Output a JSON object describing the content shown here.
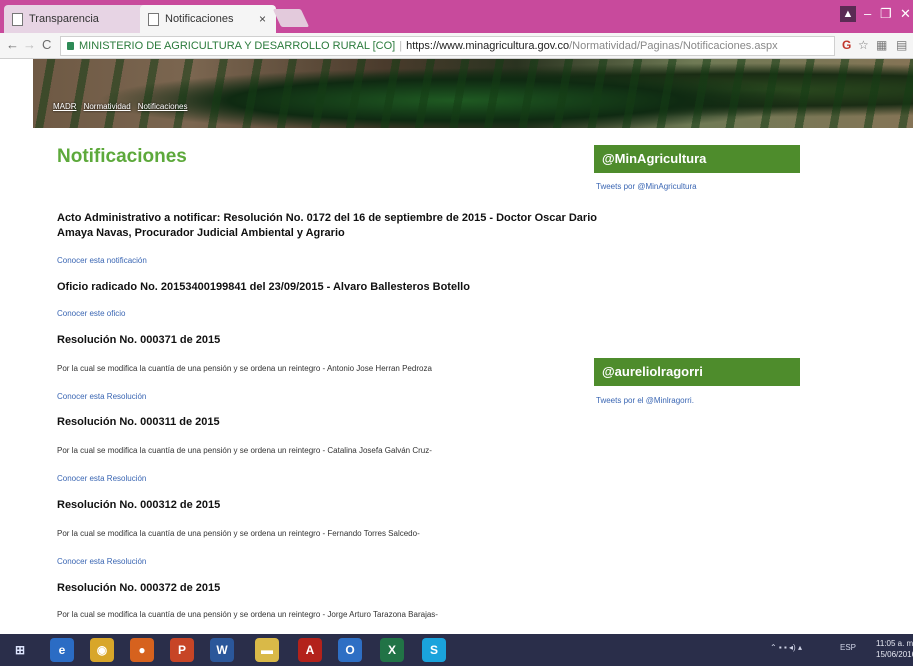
{
  "browser": {
    "tabs": [
      {
        "label": "Transparencia"
      },
      {
        "label": "Notificaciones"
      }
    ],
    "address": {
      "site_identity": "MINISTERIO DE AGRICULTURA Y DESARROLLO RURAL [CO]",
      "url_host": "https://www.minagricultura.gov.co",
      "url_path": "/Normatividad/Paginas/Notificaciones.aspx"
    }
  },
  "breadcrumb": [
    "MADR",
    "Normatividad",
    "Notificaciones"
  ],
  "page_title": "Notificaciones",
  "items": [
    {
      "title": "Acto Administrativo a notificar: Resolución No. 0172 del 16 de septiembre de 2015 - Doctor Oscar Dario Amaya Navas, Procurador Judicial Ambiental y Agrario",
      "link": "Conocer esta notificación"
    },
    {
      "title": "Oficio radicado No. 20153400199841 del 23/09/2015 - Alvaro Ballesteros Botello",
      "link": "Conocer este oficio"
    },
    {
      "title": "Resolución No. 000371 de 2015",
      "desc": "Por la cual se modifica la cuantía de una pensión y se ordena un reintegro - Antonio Jose Herran Pedroza",
      "link": "Conocer esta Resolución"
    },
    {
      "title": "Resolución No. 000311 de 2015",
      "desc": "Por la cual se modifica la cuantía de una pensión y se ordena un reintegro - Catalina Josefa Galván Cruz-",
      "link": "Conocer esta Resolución"
    },
    {
      "title": "Resolución No. 000312 de 2015",
      "desc": "Por la cual se modifica la cuantía de una pensión y se ordena un reintegro - Fernando Torres Salcedo-",
      "link": "Conocer esta Resolución"
    },
    {
      "title": "Resolución No. 000372 de 2015",
      "desc": "Por la cual se modifica la cuantía de una pensión y se ordena un reintegro - Jorge Arturo Tarazona Barajas-"
    }
  ],
  "sidebar": {
    "box1_title": "@MinAgricultura",
    "box1_link": "Tweets por @MinAgricultura",
    "box2_title": "@aureliolragorri",
    "box2_link": "Tweets por el @Minlragorri."
  },
  "taskbar": {
    "apps": [
      "internet-explorer",
      "chrome",
      "firefox",
      "powerpoint",
      "word",
      "file-explorer",
      "acrobat",
      "outlook",
      "excel",
      "skype"
    ],
    "lang": "ESP",
    "time": "11:05 a. m.",
    "date": "15/06/2016"
  }
}
